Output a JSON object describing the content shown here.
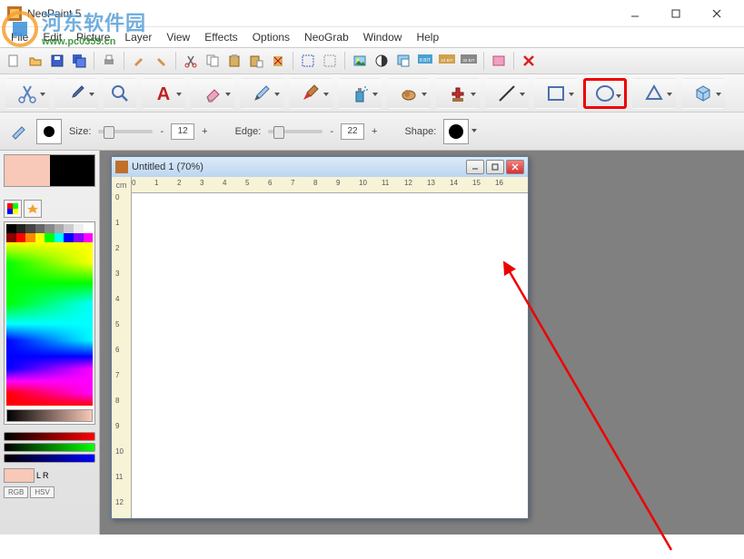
{
  "window": {
    "title": "NeoPaint 5"
  },
  "menu": {
    "items": [
      "File",
      "Edit",
      "Picture",
      "Layer",
      "View",
      "Effects",
      "Options",
      "NeoGrab",
      "Window",
      "Help"
    ]
  },
  "watermark": {
    "line1": "河东软件园",
    "line2": "www.pc0359.cn"
  },
  "toolbar1": {
    "icons": [
      "new-icon",
      "open-icon",
      "save-icon",
      "save-all-icon",
      "print-icon",
      "brush-icon",
      "eraser-icon",
      "cut-icon",
      "copy-icon",
      "paste-icon",
      "paste-new-icon",
      "delete-icon",
      "select-all-icon",
      "deselect-icon",
      "image-icon",
      "contrast-icon",
      "resize-icon",
      "8bit-icon",
      "24bit-icon",
      "32bit-icon",
      "effects-icon",
      "close-red-icon"
    ]
  },
  "toolbar2": {
    "tools": [
      {
        "name": "scissors-tool",
        "dd": true
      },
      {
        "name": "eyedropper-tool",
        "dd": true
      },
      {
        "name": "zoom-tool",
        "dd": false
      },
      {
        "name": "text-tool",
        "dd": true
      },
      {
        "name": "eraser-tool",
        "dd": true
      },
      {
        "name": "pencil-tool",
        "dd": true
      },
      {
        "name": "brush-tool",
        "dd": true
      },
      {
        "name": "spray-tool",
        "dd": true
      },
      {
        "name": "stamp-tool",
        "dd": true
      },
      {
        "name": "clone-tool",
        "dd": true
      },
      {
        "name": "line-tool",
        "dd": true
      },
      {
        "name": "rectangle-tool",
        "dd": true
      },
      {
        "name": "ellipse-tool",
        "dd": true,
        "highlight": true
      },
      {
        "name": "polygon-tool",
        "dd": true
      },
      {
        "name": "cube-tool",
        "dd": true
      }
    ]
  },
  "options": {
    "size_label": "Size:",
    "size_value": "12",
    "edge_label": "Edge:",
    "edge_value": "22",
    "shape_label": "Shape:"
  },
  "colors": {
    "fg": "#f8c8b8",
    "bg": "#000000",
    "grays": [
      "#000",
      "#222",
      "#444",
      "#666",
      "#888",
      "#aaa",
      "#ccc",
      "#eee",
      "#fff"
    ],
    "row": [
      "#800",
      "#f00",
      "#f80",
      "#ff0",
      "#0f0",
      "#0ff",
      "#00f",
      "#80f",
      "#f0f"
    ],
    "rgb": [
      "#d22",
      "#2c2",
      "#36f"
    ],
    "tabs_labels": [
      "RGB",
      "HSV"
    ],
    "lr_labels": [
      "L",
      "R"
    ]
  },
  "document": {
    "title": "Untitled 1 (70%)",
    "corner": "cm",
    "hticks": [
      "0",
      "1",
      "2",
      "3",
      "4",
      "5",
      "6",
      "7",
      "8",
      "9",
      "10",
      "11",
      "12",
      "13",
      "14",
      "15",
      "16"
    ],
    "vticks": [
      "0",
      "1",
      "2",
      "3",
      "4",
      "5",
      "6",
      "7",
      "8",
      "9",
      "10",
      "11",
      "12"
    ]
  }
}
